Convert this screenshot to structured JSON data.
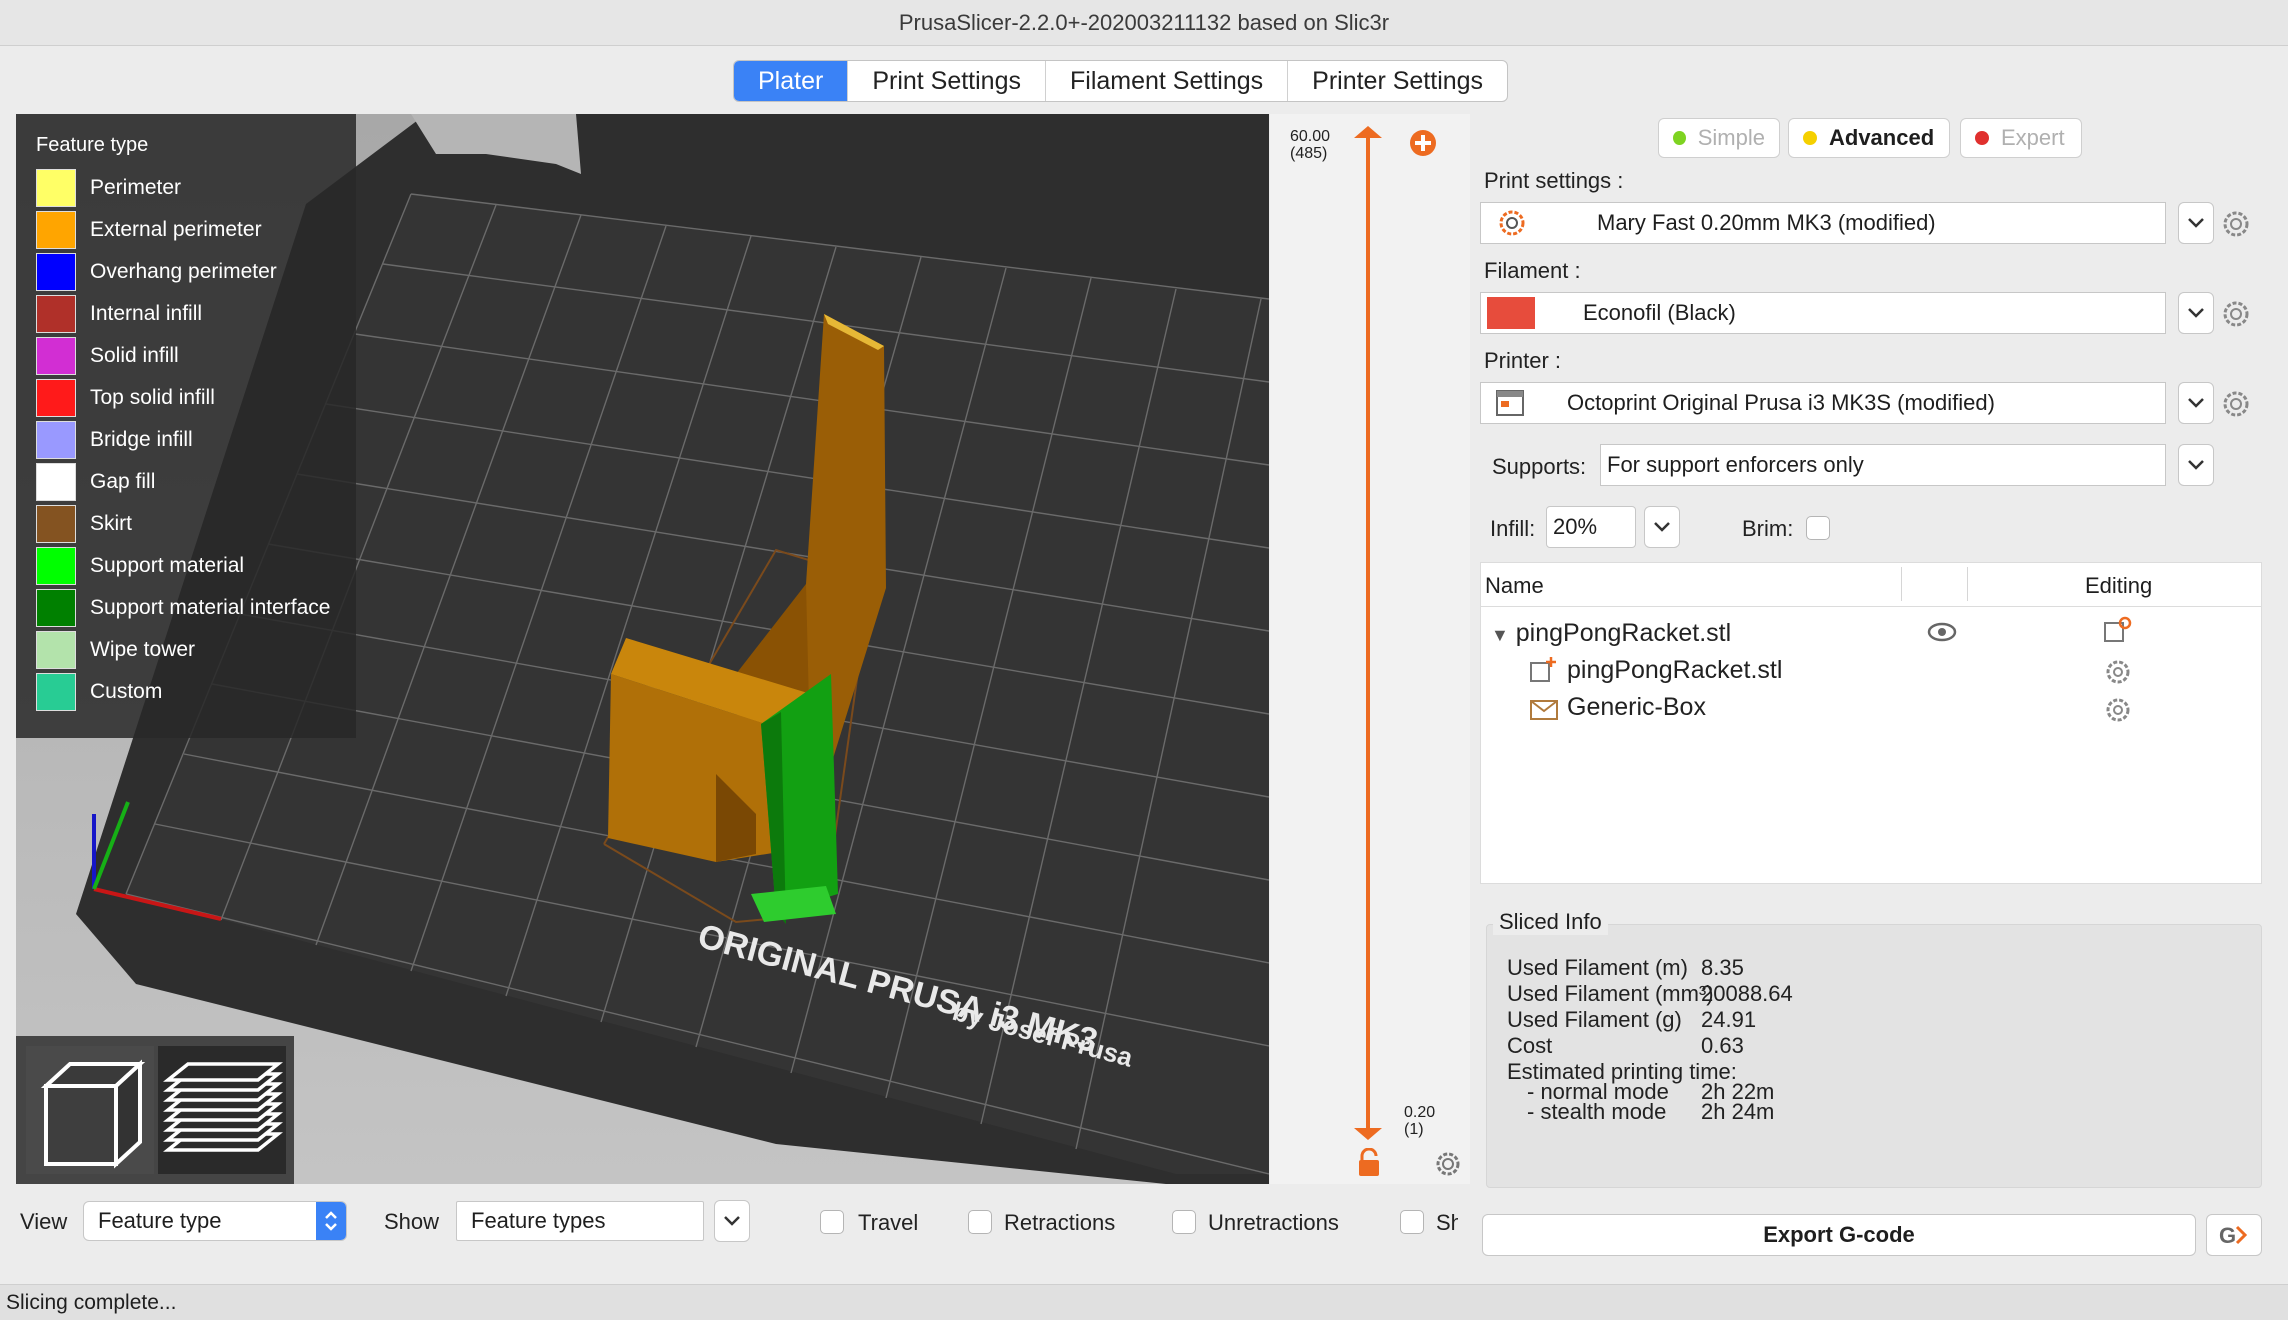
{
  "window": {
    "title": "PrusaSlicer-2.2.0+-202003211132 based on Slic3r"
  },
  "tabs": [
    {
      "label": "Plater",
      "active": true
    },
    {
      "label": "Print Settings"
    },
    {
      "label": "Filament Settings"
    },
    {
      "label": "Printer Settings"
    }
  ],
  "legend": {
    "title": "Feature type",
    "items": [
      {
        "label": "Perimeter",
        "color": "#ffff66"
      },
      {
        "label": "External perimeter",
        "color": "#ffa500"
      },
      {
        "label": "Overhang perimeter",
        "color": "#0000ff"
      },
      {
        "label": "Internal infill",
        "color": "#b03029"
      },
      {
        "label": "Solid infill",
        "color": "#d22ed3"
      },
      {
        "label": "Top solid infill",
        "color": "#ff1a1a"
      },
      {
        "label": "Bridge infill",
        "color": "#9999ff"
      },
      {
        "label": "Gap fill",
        "color": "#ffffff"
      },
      {
        "label": "Skirt",
        "color": "#845321"
      },
      {
        "label": "Support material",
        "color": "#00ff00"
      },
      {
        "label": "Support material interface",
        "color": "#008000"
      },
      {
        "label": "Wipe tower",
        "color": "#b3e3ab"
      },
      {
        "label": "Custom",
        "color": "#28cc94"
      }
    ]
  },
  "bed": {
    "brand_line1": "ORIGINAL PRUSA i3 MK3",
    "brand_line2": "by Josef Prusa"
  },
  "layer_slider": {
    "top_value": "60.00",
    "top_layer": "(485)",
    "bottom_value": "0.20",
    "bottom_layer": "(1)",
    "accent": "#ed6b21"
  },
  "modes": [
    {
      "label": "Simple",
      "color": "#7ed321",
      "active": false
    },
    {
      "label": "Advanced",
      "color": "#f5d000",
      "active": true
    },
    {
      "label": "Expert",
      "color": "#e0302e",
      "active": false
    }
  ],
  "settings": {
    "print_label": "Print settings :",
    "print_value": "Mary Fast 0.20mm MK3 (modified)",
    "filament_label": "Filament :",
    "filament_value": "Econofil (Black)",
    "filament_color": "#e74c3c",
    "printer_label": "Printer :",
    "printer_value": "Octoprint Original Prusa i3 MK3S (modified)",
    "supports_label": "Supports:",
    "supports_value": "For support enforcers only",
    "infill_label": "Infill:",
    "infill_value": "20%",
    "brim_label": "Brim:"
  },
  "object_list": {
    "col_name": "Name",
    "col_editing": "Editing",
    "rows": [
      {
        "label": "pingPongRacket.stl"
      },
      {
        "label": "pingPongRacket.stl"
      },
      {
        "label": "Generic-Box"
      }
    ]
  },
  "sliced_info": {
    "title": "Sliced Info",
    "rows": [
      {
        "k": "Used Filament (m)",
        "v": "8.35"
      },
      {
        "k": "Used Filament (mm³)",
        "v": "20088.64"
      },
      {
        "k": "Used Filament (g)",
        "v": "24.91"
      },
      {
        "k": "Cost",
        "v": "0.63"
      },
      {
        "k": "Estimated printing time:",
        "v": ""
      },
      {
        "k": "- normal mode",
        "v": "2h 22m"
      },
      {
        "k": "- stealth mode",
        "v": "2h 24m"
      }
    ]
  },
  "export_label": "Export G-code",
  "bottom": {
    "view_label": "View",
    "view_value": "Feature type",
    "show_label": "Show",
    "show_value": "Feature types",
    "checks": [
      "Travel",
      "Retractions",
      "Unretractions",
      "Sh"
    ]
  },
  "status": "Slicing complete..."
}
